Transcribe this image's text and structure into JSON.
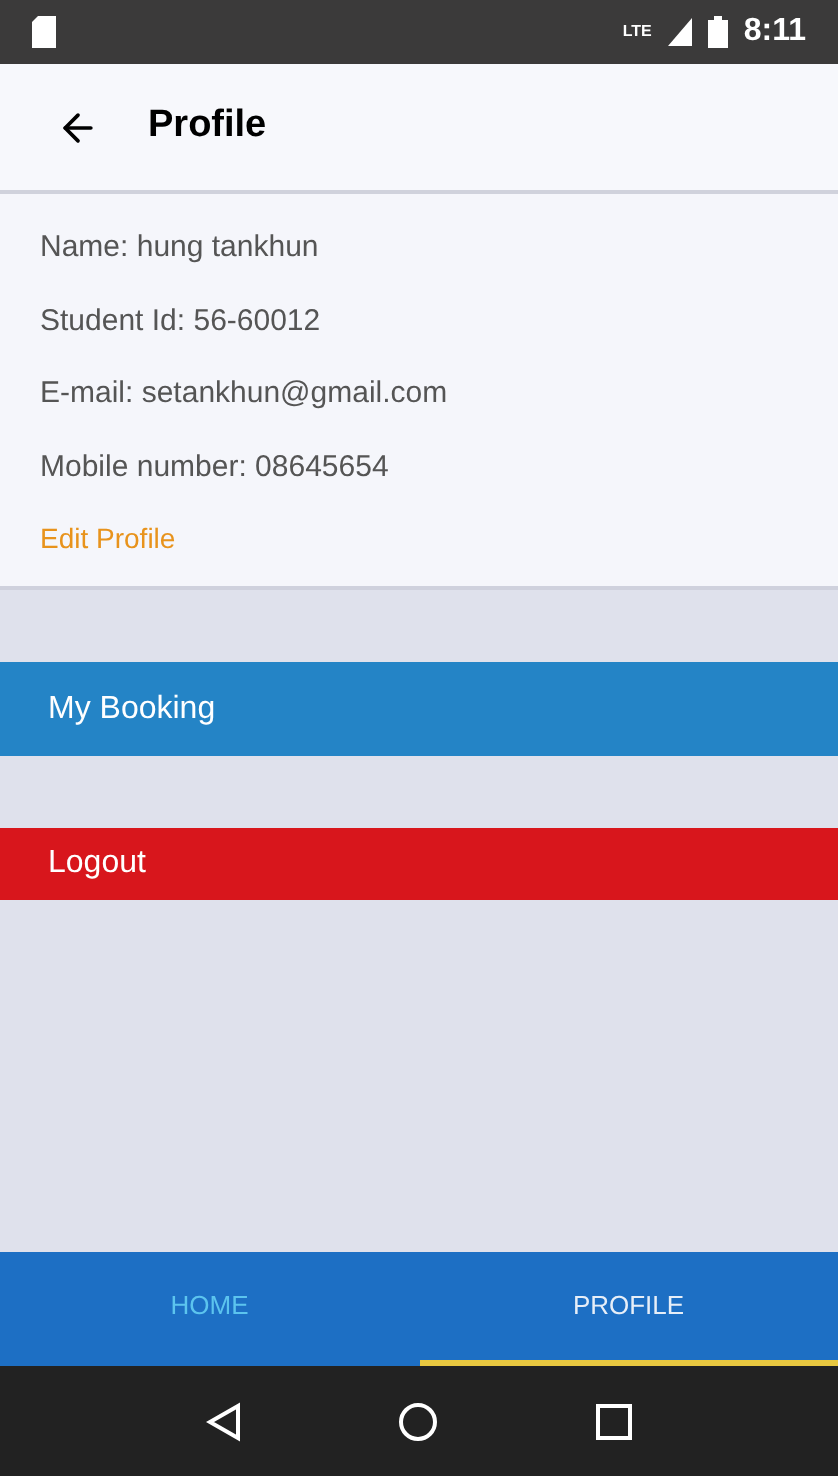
{
  "status_bar": {
    "network": "LTE",
    "time": "8:11"
  },
  "app_bar": {
    "title": "Profile"
  },
  "profile": {
    "fields": [
      "Name: hung tankhun",
      "Student Id: 56-60012",
      "E-mail: setankhun@gmail.com",
      "Mobile number: 08645654"
    ],
    "edit_link": "Edit Profile"
  },
  "actions": [
    {
      "label": "My Booking",
      "color": "#2484c6"
    },
    {
      "label": "Logout",
      "color": "#d8161c"
    }
  ],
  "tabs": [
    {
      "label": "HOME",
      "selected": false
    },
    {
      "label": "PROFILE",
      "selected": true
    }
  ]
}
